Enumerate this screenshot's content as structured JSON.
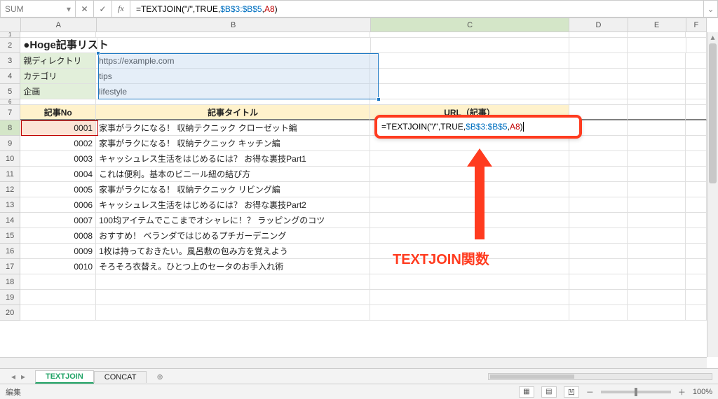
{
  "name_box": "SUM",
  "formula_tokens": {
    "pre": "=TEXTJOIN(\"/\",TRUE,",
    "range": "$B$3:$B$5",
    "comma": ",",
    "ref": "A8",
    "post": ")"
  },
  "columns": [
    "A",
    "B",
    "C",
    "D",
    "E",
    "F"
  ],
  "title": "●Hoge記事リスト",
  "params": [
    {
      "label": "親ディレクトリ",
      "value": "https://example.com"
    },
    {
      "label": "カテゴリ",
      "value": "tips"
    },
    {
      "label": "企画",
      "value": "lifestyle"
    }
  ],
  "headers": {
    "a": "記事No",
    "b": "記事タイトル",
    "c": "URL（記事）"
  },
  "articles": [
    {
      "no": "0001",
      "title": "家事がラクになる！ 収納テクニック クローゼット編"
    },
    {
      "no": "0002",
      "title": "家事がラクになる！ 収納テクニック キッチン編"
    },
    {
      "no": "0003",
      "title": "キャッシュレス生活をはじめるには？ お得な裏技Part1"
    },
    {
      "no": "0004",
      "title": "これは便利。基本のビニール紐の結び方"
    },
    {
      "no": "0005",
      "title": "家事がラクになる！ 収納テクニック リビング編"
    },
    {
      "no": "0006",
      "title": "キャッシュレス生活をはじめるには？ お得な裏技Part2"
    },
    {
      "no": "0007",
      "title": "100均アイテムでここまでオシャレに！？ ラッピングのコツ"
    },
    {
      "no": "0008",
      "title": "おすすめ！ ベランダではじめるプチガーデニング"
    },
    {
      "no": "0009",
      "title": "1枚は持っておきたい。風呂敷の包み方を覚えよう"
    },
    {
      "no": "0010",
      "title": "そろそろ衣替え。ひとつ上のセータのお手入れ術"
    }
  ],
  "callout": "TEXTJOIN関数",
  "tabs": {
    "active": "TEXTJOIN",
    "other": "CONCAT"
  },
  "status": {
    "mode": "編集",
    "zoom": "100%"
  },
  "chart_data": null
}
